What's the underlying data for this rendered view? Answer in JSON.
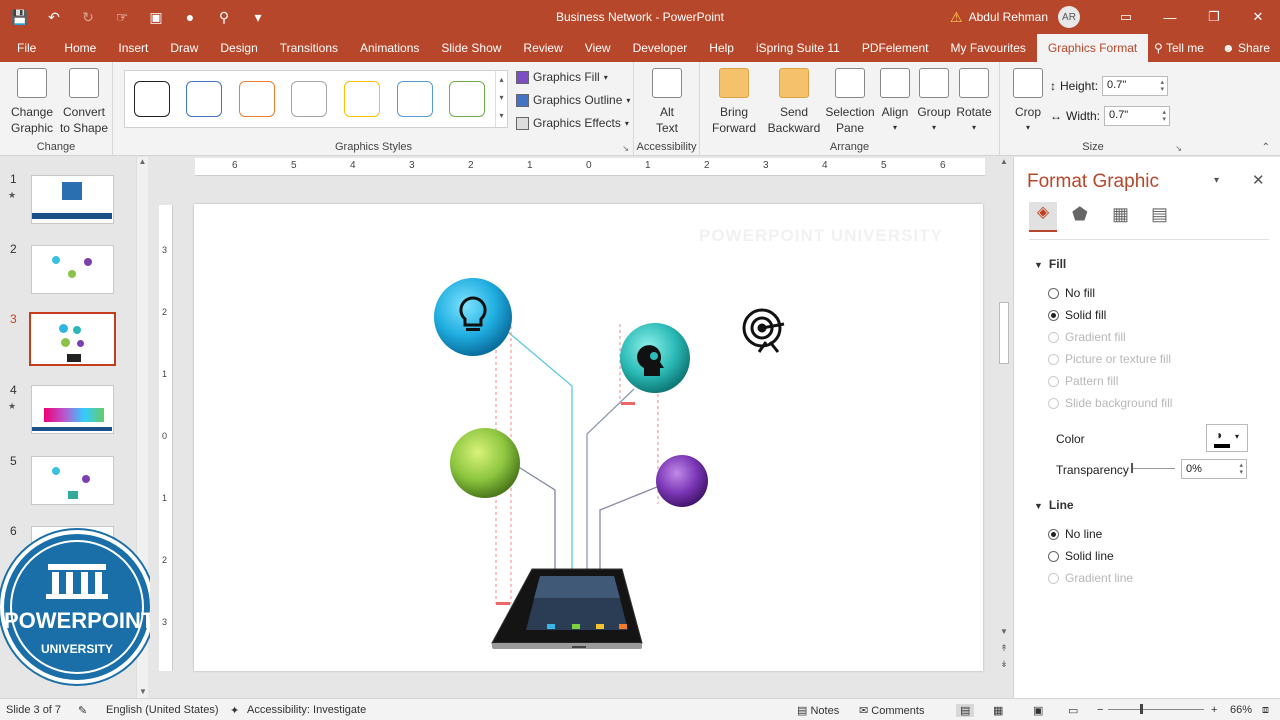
{
  "titlebar": {
    "title": "Business Network - PowerPoint",
    "user": "Abdul Rehman",
    "initials": "AR"
  },
  "tabs": [
    "File",
    "Home",
    "Insert",
    "Draw",
    "Design",
    "Transitions",
    "Animations",
    "Slide Show",
    "Review",
    "View",
    "Developer",
    "Help",
    "iSpring Suite 11",
    "PDFelement",
    "My Favourites",
    "Graphics Format"
  ],
  "tabs_right": [
    "Tell me",
    "Share"
  ],
  "ribbon": {
    "change": {
      "label": "Change",
      "btn1_a": "Change",
      "btn1_b": "Graphic",
      "btn2_a": "Convert",
      "btn2_b": "to Shape"
    },
    "styles": {
      "label": "Graphics Styles",
      "fill": "Graphics Fill",
      "outline": "Graphics Outline",
      "effects": "Graphics Effects",
      "swatch_colors": [
        "#222222",
        "#4472c4",
        "#ed7d31",
        "#a5a5a5",
        "#ffc000",
        "#5b9bd5",
        "#70ad47"
      ]
    },
    "accessibility": {
      "label": "Accessibility",
      "btn_a": "Alt",
      "btn_b": "Text"
    },
    "arrange": {
      "label": "Arrange",
      "bring_a": "Bring",
      "bring_b": "Forward",
      "send_a": "Send",
      "send_b": "Backward",
      "selection_a": "Selection",
      "selection_b": "Pane",
      "align": "Align",
      "group": "Group",
      "rotate": "Rotate"
    },
    "size": {
      "label": "Size",
      "crop": "Crop",
      "height_label": "Height:",
      "height": "0.7\"",
      "width_label": "Width:",
      "width": "0.7\""
    }
  },
  "thumbnails": [
    {
      "num": "1",
      "star": "★"
    },
    {
      "num": "2",
      "star": ""
    },
    {
      "num": "3",
      "star": ""
    },
    {
      "num": "4",
      "star": "★"
    },
    {
      "num": "5",
      "star": ""
    },
    {
      "num": "6",
      "star": ""
    }
  ],
  "ruler": {
    "h": [
      "6",
      "5",
      "4",
      "3",
      "2",
      "1",
      "0",
      "1",
      "2",
      "3",
      "4",
      "5",
      "6"
    ],
    "v": [
      "3",
      "2",
      "1",
      "0",
      "1",
      "2",
      "3"
    ]
  },
  "slide": {
    "watermark": "POWERPOINT UNIVERSITY"
  },
  "pane": {
    "title": "Format Graphic",
    "fill": {
      "heading": "Fill",
      "options": [
        "No fill",
        "Solid fill",
        "Gradient fill",
        "Picture or texture fill",
        "Pattern fill",
        "Slide background fill"
      ],
      "color_label": "Color",
      "transparency_label": "Transparency",
      "transparency": "0%"
    },
    "line": {
      "heading": "Line",
      "options": [
        "No line",
        "Solid line",
        "Gradient line"
      ]
    }
  },
  "logo": {
    "line1": "POWERPOINT",
    "line2": "UNIVERSITY"
  },
  "status": {
    "slide": "Slide 3 of 7",
    "lang": "English (United States)",
    "access": "Accessibility: Investigate",
    "notes": "Notes",
    "comments": "Comments",
    "zoom": "66%"
  }
}
